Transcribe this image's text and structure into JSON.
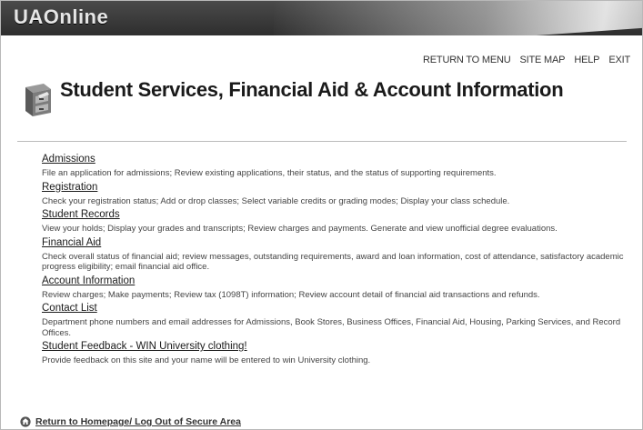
{
  "header": {
    "logo_text": "UAOnline"
  },
  "topnav": {
    "return_to_menu": "RETURN TO MENU",
    "site_map": "SITE MAP",
    "help": "HELP",
    "exit": "EXIT"
  },
  "page": {
    "title": "Student Services, Financial Aid & Account Information",
    "icon": "file-cabinet-icon"
  },
  "menu": [
    {
      "label": "Admissions",
      "description": "File an application for admissions; Review existing applications, their status, and the status of supporting requirements."
    },
    {
      "label": "Registration",
      "description": "Check your registration status; Add or drop classes; Select variable credits or grading modes; Display your class schedule."
    },
    {
      "label": "Student Records",
      "description": "View your holds; Display your grades and transcripts; Review charges and payments. Generate and view unofficial degree evaluations."
    },
    {
      "label": "Financial Aid",
      "description": "Check overall status of financial aid; review messages, outstanding requirements, award and loan information, cost of attendance, satisfactory academic progress eligibility; email financial aid office."
    },
    {
      "label": "Account Information",
      "description": "Review charges; Make payments; Review tax (1098T) information; Review account detail of financial aid transactions and refunds."
    },
    {
      "label": "Contact List",
      "description": "Department phone numbers and email addresses for Admissions, Book Stores, Business Offices, Financial Aid, Housing, Parking Services, and Record Offices."
    },
    {
      "label": "Student Feedback - WIN University clothing!",
      "description": "Provide feedback on this site and your name will be entered to win University clothing."
    }
  ],
  "footer": {
    "home_link": "Return to Homepage/ Log Out of Secure Area",
    "icon": "home-icon"
  }
}
